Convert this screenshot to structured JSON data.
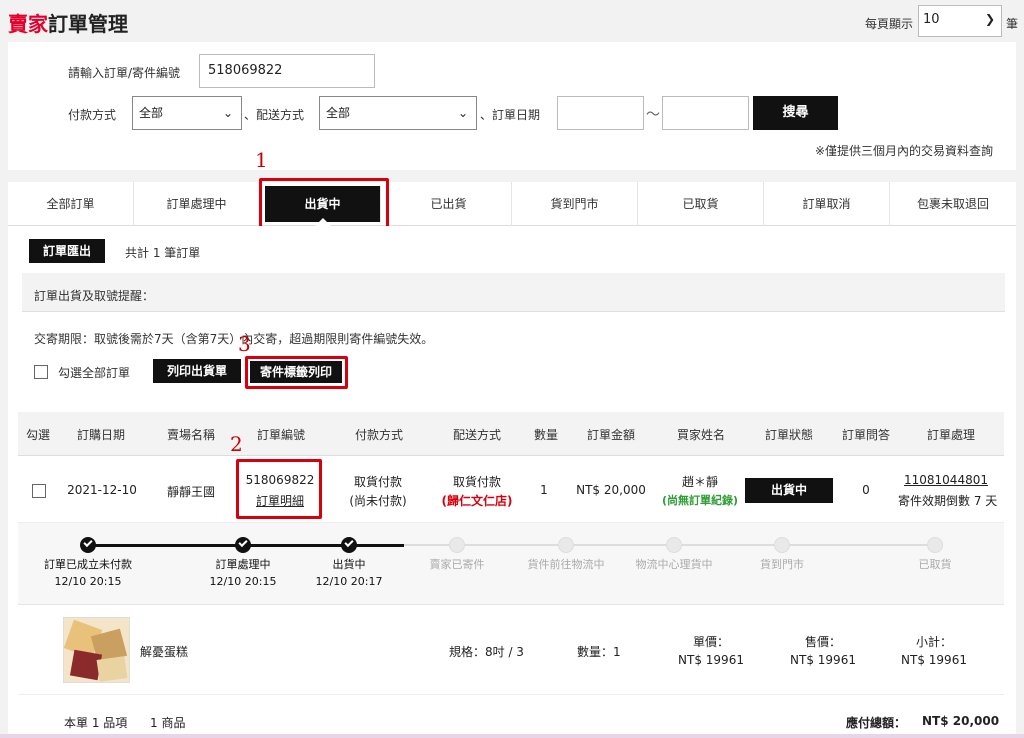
{
  "header": {
    "title_red": "賣家",
    "title_rest": "訂單管理",
    "per_page_label": "每頁顯示",
    "per_page_value": "10",
    "per_page_unit": "筆"
  },
  "search": {
    "order_label": "請輸入訂單/寄件編號",
    "order_value": "518069822",
    "payment_label": "付款方式",
    "payment_value": "全部",
    "shipping_sep": "、配送方式",
    "shipping_value": "全部",
    "date_sep": "、訂單日期",
    "tilde": "〜",
    "search_button": "搜尋",
    "note": "※僅提供三個月內的交易資料查詢"
  },
  "tabs": [
    "全部訂單",
    "訂單處理中",
    "出貨中",
    "已出貨",
    "貨到門市",
    "已取貨",
    "訂單取消",
    "包裹未取退回"
  ],
  "annotations": [
    "1",
    "2",
    "3"
  ],
  "toolbar": {
    "export_button": "訂單匯出",
    "total_text": "共計 1 筆訂單"
  },
  "reminder": {
    "title": "訂單出貨及取號提醒：",
    "text": "交寄期限：取號後需於7天（含第7天）內交寄，超過期限則寄件編號失效。"
  },
  "actions": {
    "select_all_label": "勾選全部訂單",
    "print_shipping_button": "列印出貨單",
    "print_label_button": "寄件標籤列印"
  },
  "table": {
    "headers": [
      "勾選",
      "訂購日期",
      "賣場名稱",
      "訂單編號",
      "付款方式",
      "配送方式",
      "數量",
      "訂單金額",
      "買家姓名",
      "訂單狀態",
      "訂單問答",
      "訂單處理"
    ],
    "row": {
      "date": "2021-12-10",
      "store": "靜靜王國",
      "order_no": "518069822",
      "order_detail": "訂單明細",
      "payment_line1": "取貨付款",
      "payment_line2": "(尚未付款)",
      "shipping_line1": "取貨付款",
      "shipping_line2": "(歸仁文仁店)",
      "qty": "1",
      "amount": "NT$ 20,000",
      "buyer": "趙＊靜",
      "buyer_note": "(尚無訂單紀錄)",
      "status": "出貨中",
      "qa": "0",
      "tracking_no": "11081044801",
      "tracking_note": "寄件效期倒數 7 天"
    }
  },
  "timeline": [
    {
      "label": "訂單已成立未付款",
      "time": "12/10 20:15",
      "done": true
    },
    {
      "label": "訂單處理中",
      "time": "12/10 20:15",
      "done": true
    },
    {
      "label": "出貨中",
      "time": "12/10 20:17",
      "done": true
    },
    {
      "label": "賣家已寄件",
      "time": "",
      "done": false
    },
    {
      "label": "貨件前往物流中",
      "time": "",
      "done": false
    },
    {
      "label": "物流中心理貨中",
      "time": "",
      "done": false
    },
    {
      "label": "貨到門市",
      "time": "",
      "done": false
    },
    {
      "label": "已取貨",
      "time": "",
      "done": false
    }
  ],
  "product": {
    "name": "解憂蛋糕",
    "spec": "規格：8吋 / 3",
    "qty": "數量：1",
    "unit_price_label": "單價：",
    "unit_price": "NT$ 19961",
    "sale_price_label": "售價：",
    "sale_price": "NT$ 19961",
    "subtotal_label": "小計：",
    "subtotal": "NT$ 19961"
  },
  "summary": {
    "items": "本單 1 品項",
    "goods": "1 商品",
    "total_label": "應付總額：",
    "total": "NT$ 20,000"
  },
  "colors": {
    "accent_red": "#e4002b",
    "annotation_red": "#d8000c",
    "black": "#111111",
    "green": "#2e9d35"
  }
}
